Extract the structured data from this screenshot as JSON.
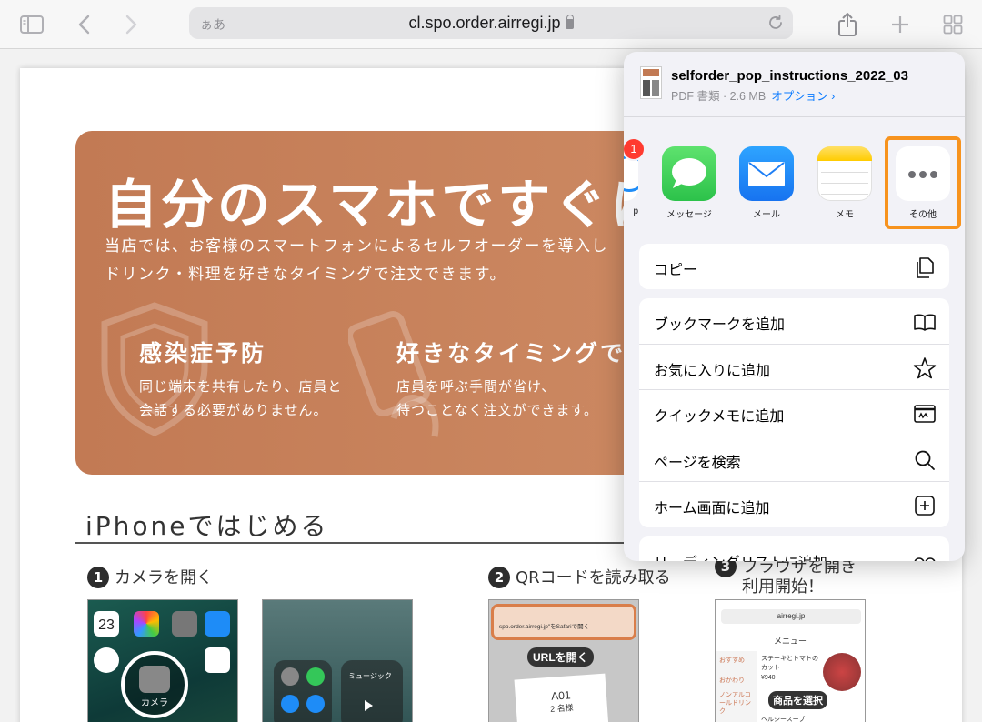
{
  "browser": {
    "address_aa": "ぁあ",
    "url": "cl.spo.order.airregi.jp"
  },
  "document": {
    "banner": {
      "title": "自分のスマホですぐに注",
      "desc_line1": "当店では、お客様のスマートフォンによるセルフオーダーを導入し",
      "desc_line2": "ドリンク・料理を好きなタイミングで注文できます。",
      "feature1_title": "感染症予防",
      "feature1_line1": "同じ端末を共有したり、店員と",
      "feature1_line2": "会話する必要がありません。",
      "feature2_title": "好きなタイミングで",
      "feature2_line1": "店員を呼ぶ手間が省け、",
      "feature2_line2": "待つことなく注文ができます。"
    },
    "section_heading": "iPhoneではじめる",
    "steps": [
      {
        "num": "1",
        "label": "カメラを開く"
      },
      {
        "num": "2",
        "label": "QRコードを読み取る"
      },
      {
        "num": "3",
        "label_line1": "ブラウザを開き",
        "label_line2": "利用開始！"
      }
    ],
    "shot1": {
      "date": "23",
      "camera_label": "カメラ"
    },
    "shot2": {
      "music_label": "ミュージック"
    },
    "shot3": {
      "qr_title": "spo.order.airregi.jp\"をSafariで開く",
      "open_url": "URLを開く",
      "table": "A01",
      "guests": "2 名様"
    },
    "shot4": {
      "domain": "airregi.jp",
      "menu": "メニュー",
      "tab1": "おすすめ",
      "tab2": "おかわり",
      "tab3": "ノンアルコールドリンク",
      "item": "ステーキとトマトのカット",
      "price": "¥940",
      "select": "商品を選択",
      "item2": "ヘルシースープ"
    }
  },
  "share_sheet": {
    "file_name": "selforder_pop_instructions_2022_03",
    "file_meta": "PDF 書類 · 2.6 MB",
    "options_label": "オプション ›",
    "badge_count": "1",
    "apps": [
      {
        "label": "p",
        "icon": "partial-app-icon"
      },
      {
        "label": "メッセージ",
        "icon": "messages-icon",
        "color": "#34c759"
      },
      {
        "label": "メール",
        "icon": "mail-icon",
        "color": "#1e8cf7"
      },
      {
        "label": "メモ",
        "icon": "notes-icon",
        "color": "#ffd60a"
      },
      {
        "label": "その他",
        "icon": "more-icon"
      }
    ],
    "actions": {
      "copy": "コピー",
      "add_bookmark": "ブックマークを追加",
      "add_favorites": "お気に入りに追加",
      "add_quick_note": "クイックメモに追加",
      "find_on_page": "ページを検索",
      "add_home_screen": "ホーム画面に追加",
      "add_reading_list": "リーディングリストに追加"
    },
    "highlight_color": "#f7931e"
  }
}
